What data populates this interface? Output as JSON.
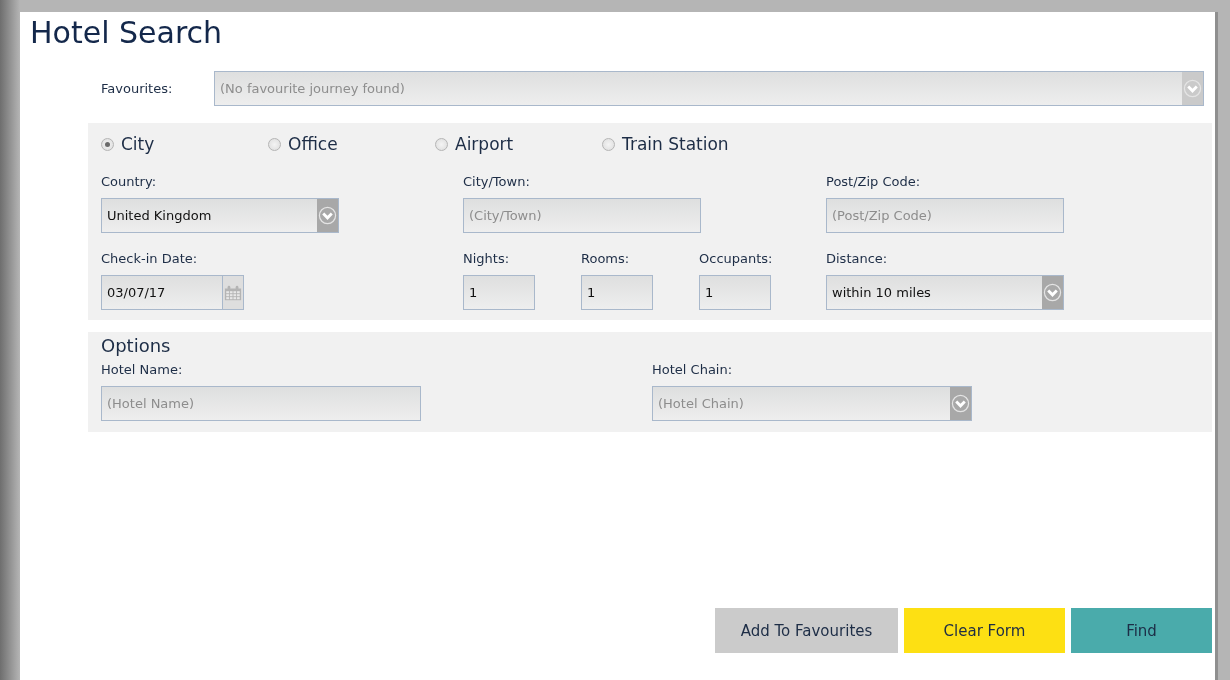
{
  "title": "Hotel Search",
  "favourites": {
    "label": "Favourites:",
    "kind": "select",
    "placeholder": "(No favourite journey found)"
  },
  "location_types": [
    {
      "label": "City",
      "selected": true
    },
    {
      "label": "Office",
      "selected": false
    },
    {
      "label": "Airport",
      "selected": false
    },
    {
      "label": "Train Station",
      "selected": false
    }
  ],
  "location_fields": [
    {
      "kind": "select",
      "label": "Country:",
      "value": "United Kingdom"
    },
    {
      "kind": "text",
      "label": "City/Town:",
      "placeholder": "(City/Town)"
    },
    {
      "kind": "text",
      "label": "Post/Zip Code:",
      "placeholder": "(Post/Zip Code)"
    }
  ],
  "booking_fields": [
    {
      "kind": "date",
      "label": "Check-in Date:",
      "value": "03/07/17"
    },
    {
      "kind": "number",
      "label": "Nights:",
      "value": "1"
    },
    {
      "kind": "number",
      "label": "Rooms:",
      "value": "1"
    },
    {
      "kind": "number",
      "label": "Occupants:",
      "value": "1"
    },
    {
      "kind": "select",
      "label": "Distance:",
      "value": "within 10 miles"
    }
  ],
  "options": {
    "title": "Options",
    "fields": [
      {
        "kind": "text",
        "label": "Hotel Name:",
        "placeholder": "(Hotel Name)"
      },
      {
        "kind": "select",
        "label": "Hotel Chain:",
        "placeholder": "(Hotel Chain)"
      }
    ]
  },
  "buttons": [
    {
      "label": "Add To Favourites",
      "kind": "secondary"
    },
    {
      "label": "Clear Form",
      "kind": "warning"
    },
    {
      "label": "Find",
      "kind": "primary"
    }
  ]
}
